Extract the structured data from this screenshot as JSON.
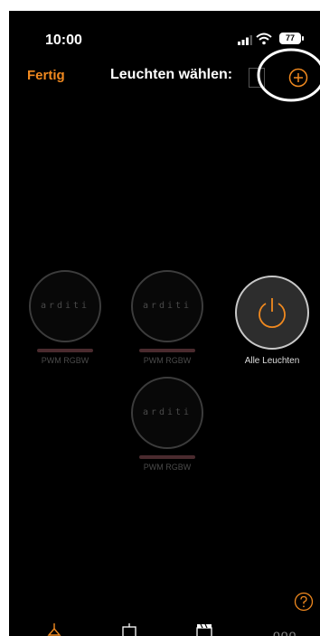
{
  "status": {
    "time": "10:00",
    "battery": "77"
  },
  "nav": {
    "done_label": "Fertig",
    "title": "Leuchten wählen:"
  },
  "lamps": [
    {
      "logo": "arditi",
      "label": "PWM RGBW"
    },
    {
      "logo": "arditi",
      "label": "PWM RGBW"
    },
    {
      "logo": "arditi",
      "label": "PWM RGBW"
    }
  ],
  "all_lamps": {
    "label": "Alle Leuchten"
  },
  "tabs": [
    {
      "icon": "lamp-icon"
    },
    {
      "icon": "scene-icon"
    },
    {
      "icon": "clapperboard-icon"
    },
    {
      "icon": "more-icon",
      "label": "ooo"
    }
  ],
  "colors": {
    "accent": "#f0891f",
    "background": "#000000",
    "highlight": "#ffffff"
  }
}
